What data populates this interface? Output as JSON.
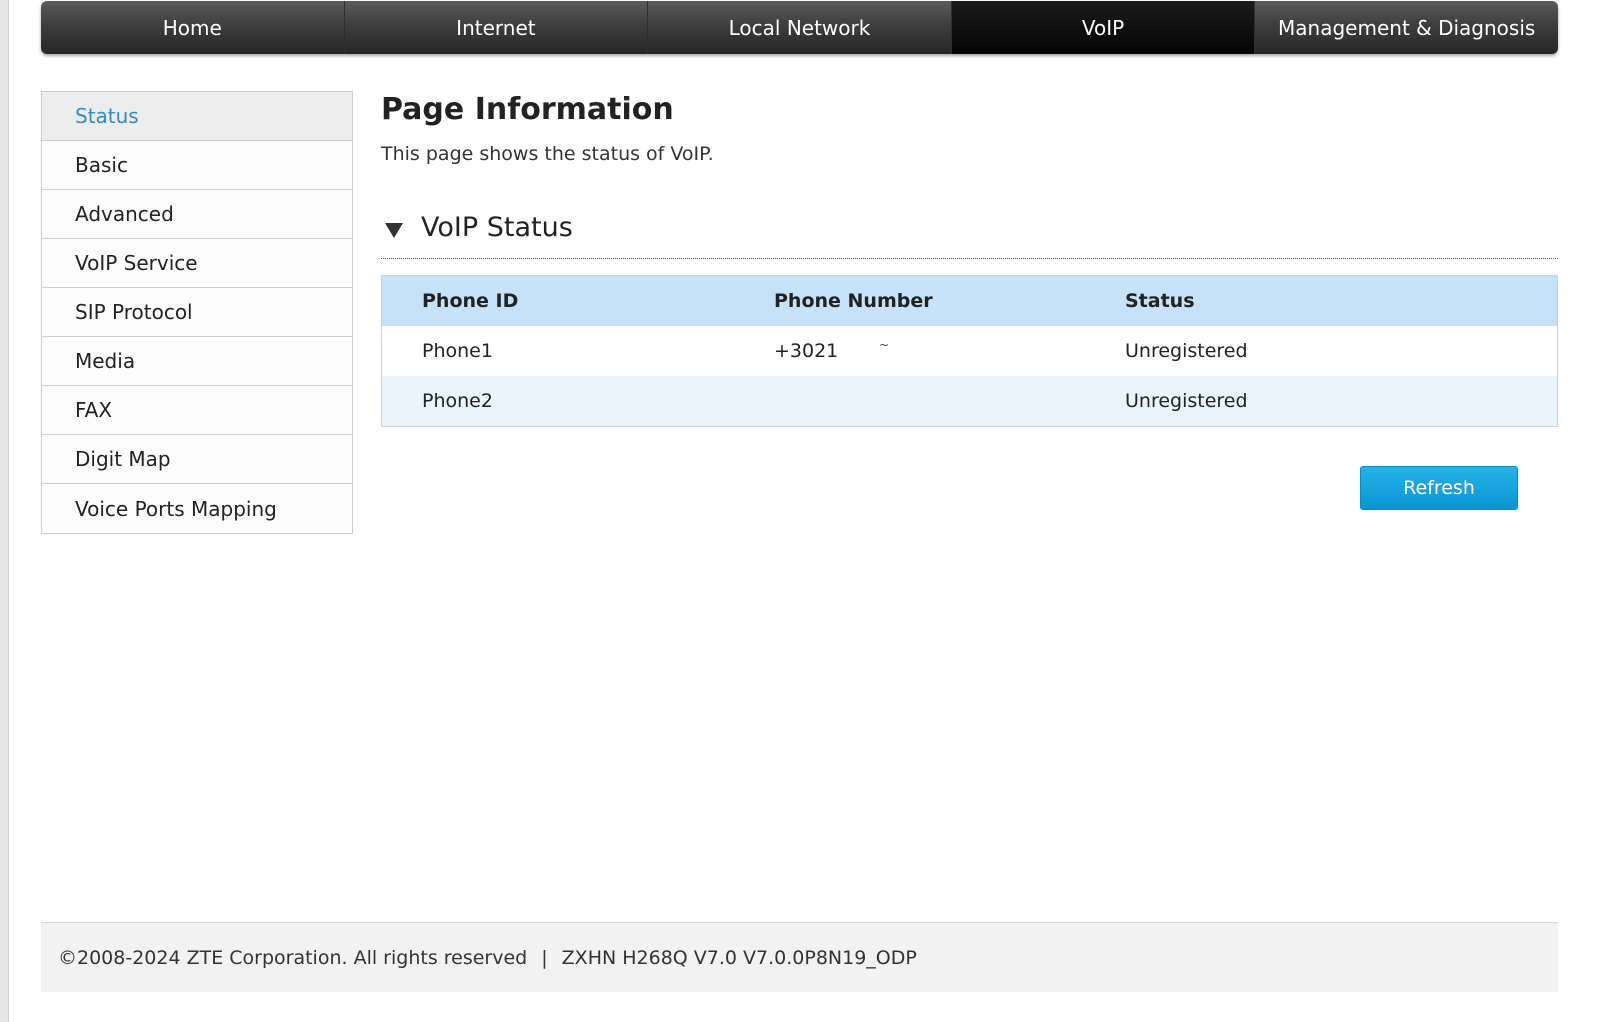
{
  "topnav": {
    "items": [
      {
        "label": "Home"
      },
      {
        "label": "Internet"
      },
      {
        "label": "Local Network"
      },
      {
        "label": "VoIP",
        "active": true
      },
      {
        "label": "Management & Diagnosis"
      }
    ]
  },
  "sidebar": {
    "items": [
      {
        "label": "Status",
        "active": true
      },
      {
        "label": "Basic"
      },
      {
        "label": "Advanced"
      },
      {
        "label": "VoIP Service"
      },
      {
        "label": "SIP Protocol"
      },
      {
        "label": "Media"
      },
      {
        "label": "FAX"
      },
      {
        "label": "Digit Map"
      },
      {
        "label": "Voice Ports Mapping"
      }
    ]
  },
  "main": {
    "title": "Page Information",
    "description": "This page shows the status of VoIP.",
    "section": {
      "title": "VoIP Status",
      "icon": "triangle-down-icon"
    },
    "table": {
      "headers": [
        "Phone ID",
        "Phone Number",
        "Status"
      ],
      "rows": [
        {
          "phone_id": "Phone1",
          "phone_number": "+3021",
          "mark": "~",
          "status": "Unregistered"
        },
        {
          "phone_id": "Phone2",
          "phone_number": "",
          "status": "Unregistered"
        }
      ]
    },
    "refresh_label": "Refresh"
  },
  "footer": {
    "copyright": "©2008-2024 ZTE Corporation. All rights reserved",
    "separator": "|",
    "model": "ZXHN H268Q V7.0 V7.0.0P8N19_ODP"
  },
  "colors": {
    "accent": "#2f8ec9",
    "button": "#0a95d2",
    "table_header": "#c5e2f8",
    "nav_dark": "#262626"
  }
}
